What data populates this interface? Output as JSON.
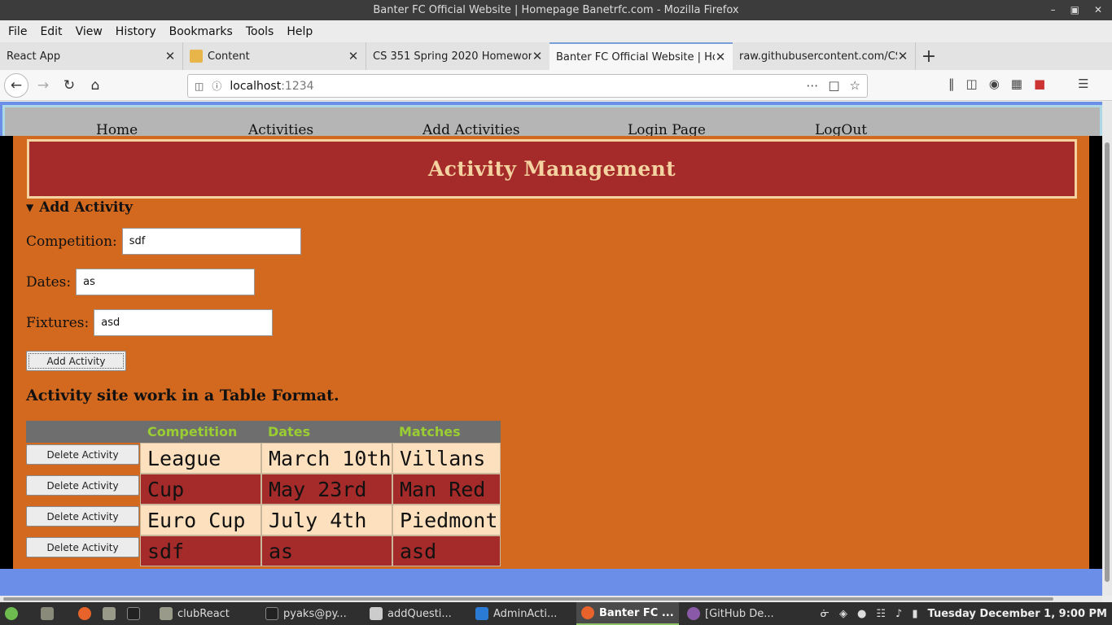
{
  "window": {
    "title": "Banter FC Official Website | Homepage Banetrfc.com - Mozilla Firefox"
  },
  "menubar": [
    "File",
    "Edit",
    "View",
    "History",
    "Bookmarks",
    "Tools",
    "Help"
  ],
  "tabs": [
    {
      "label": "React App"
    },
    {
      "label": "Content"
    },
    {
      "label": "CS 351 Spring 2020 Homework"
    },
    {
      "label": "Banter FC Official Website | Ho"
    },
    {
      "label": "raw.githubusercontent.com/CS"
    }
  ],
  "urlbar": {
    "host": "localhost",
    "port": ":1234"
  },
  "site": {
    "nav": [
      "Home",
      "Activities",
      "Add Activities",
      "Login Page",
      "LogOut"
    ],
    "banner_title": "Activity Management",
    "summary_label": "Add Activity",
    "fields": [
      {
        "label": "Competition:",
        "value": "sdf"
      },
      {
        "label": "Dates:",
        "value": "as"
      },
      {
        "label": "Fixtures:",
        "value": "asd"
      }
    ],
    "add_button": "Add Activity",
    "subtitle": "Activity site work in a Table Format.",
    "table": {
      "headers": [
        "Competition",
        "Dates",
        "Matches"
      ],
      "delete_label": "Delete Activity",
      "rows": [
        [
          "League",
          "March 10th",
          "Villans"
        ],
        [
          "Cup",
          "May 23rd",
          "Man Red"
        ],
        [
          "Euro Cup",
          "July 4th",
          "Piedmont"
        ],
        [
          "sdf",
          "as",
          "asd"
        ]
      ]
    }
  },
  "taskbar": {
    "items": [
      "clubReact",
      "pyaks@py...",
      "addQuesti...",
      "AdminActi...",
      "Banter FC ...",
      "[GitHub De..."
    ],
    "clock": "Tuesday December  1,  9:00 PM"
  },
  "colors": {
    "page_bg": "#d2691e",
    "banner_bg": "#a52a2a",
    "banner_text": "#f5d3a0",
    "header_text": "#9acd32",
    "row_light": "#fde0bd",
    "row_dark": "#a52a2a"
  }
}
